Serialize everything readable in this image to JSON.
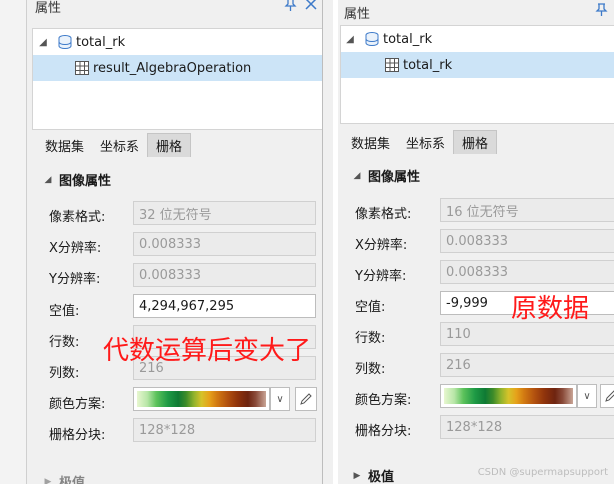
{
  "left": {
    "panel_title": "属性",
    "tree": {
      "root": "total_rk",
      "child": "result_AlgebraOperation"
    },
    "tabs": [
      "数据集",
      "坐标系",
      "栅格"
    ],
    "section_title": "图像属性",
    "fields": {
      "pixel_format": {
        "label": "像素格式:",
        "value": "32 位无符号"
      },
      "x_res": {
        "label": "X分辨率:",
        "value": "0.008333"
      },
      "y_res": {
        "label": "Y分辨率:",
        "value": "0.008333"
      },
      "nodata": {
        "label": "空值:",
        "value": "4,294,967,295"
      },
      "rows": {
        "label": "行数:",
        "value": ""
      },
      "cols": {
        "label": "列数:",
        "value": "216"
      },
      "color_scheme": {
        "label": "颜色方案:"
      },
      "block": {
        "label": "栅格分块:",
        "value": "128*128"
      }
    },
    "annotation": "代数运算后变大了",
    "cut_section": "极值"
  },
  "right": {
    "panel_title": "属性",
    "tree": {
      "root": "total_rk",
      "child": "total_rk"
    },
    "tabs": [
      "数据集",
      "坐标系",
      "栅格"
    ],
    "section_title": "图像属性",
    "fields": {
      "pixel_format": {
        "label": "像素格式:",
        "value": "16 位无符号"
      },
      "x_res": {
        "label": "X分辨率:",
        "value": "0.008333"
      },
      "y_res": {
        "label": "Y分辨率:",
        "value": "0.008333"
      },
      "nodata": {
        "label": "空值:",
        "value": "-9,999"
      },
      "rows": {
        "label": "行数:",
        "value": "110"
      },
      "cols": {
        "label": "列数:",
        "value": "216"
      },
      "color_scheme": {
        "label": "颜色方案:"
      },
      "block": {
        "label": "栅格分块:",
        "value": "128*128"
      }
    },
    "annotation": "原数据",
    "section2": "极值"
  },
  "watermark": "CSDN @supermapsupport",
  "colors": {
    "selection": "#cce4f7",
    "annotation": "#ff1a1a",
    "icon_blue": "#3d7ac9"
  }
}
